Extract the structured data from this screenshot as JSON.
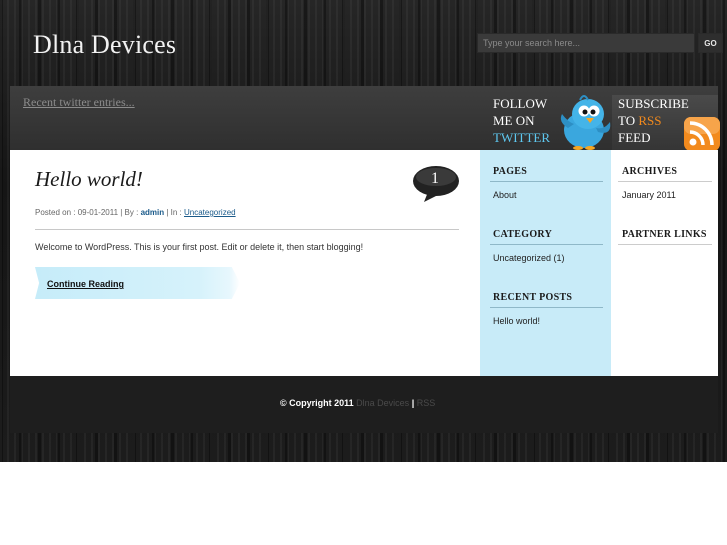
{
  "header": {
    "site_title": "Dlna Devices",
    "search_placeholder": "Type your search here...",
    "search_button": "GO"
  },
  "twitter_bar": {
    "recent_entries_link": "Recent twitter entries...",
    "follow": {
      "line1": "FOLLOW",
      "line2": "ME ON",
      "line3": "TWITTER"
    },
    "subscribe": {
      "line1": "SUBSCRIBE",
      "line2_prefix": "TO ",
      "line2_accent": "RSS",
      "line3": "FEED"
    }
  },
  "post": {
    "title": "Hello world!",
    "comment_count": "1",
    "meta_prefix": "Posted on : 09-01-2011 | By : ",
    "author": "admin",
    "meta_mid": " | In : ",
    "category": "Uncategorized",
    "body": "Welcome to WordPress. This is your first post. Edit or delete it, then start blogging!",
    "continue_label": "Continue Reading"
  },
  "sidebar_left": {
    "pages_heading": "PAGES",
    "pages": [
      "About"
    ],
    "category_heading": "CATEGORY",
    "categories": [
      "Uncategorized (1)"
    ],
    "recent_heading": "RECENT POSTS",
    "recent": [
      "Hello world!"
    ]
  },
  "sidebar_right": {
    "archives_heading": "ARCHIVES",
    "archives": [
      "January 2011"
    ],
    "partner_heading": "PARTNER LINKS"
  },
  "footer": {
    "copyright": "© Copyright 2011 ",
    "site_link": "Dlna Devices",
    "separator": " | ",
    "rss_link": "RSS"
  },
  "colors": {
    "sidebar_blue": "#c8ebf8",
    "twitter_accent": "#5ec8f0",
    "rss_orange": "#f28a1d",
    "link_blue": "#1a5a8a"
  },
  "icons": [
    "twitter-bird-icon",
    "rss-icon",
    "comment-bubble-icon"
  ]
}
